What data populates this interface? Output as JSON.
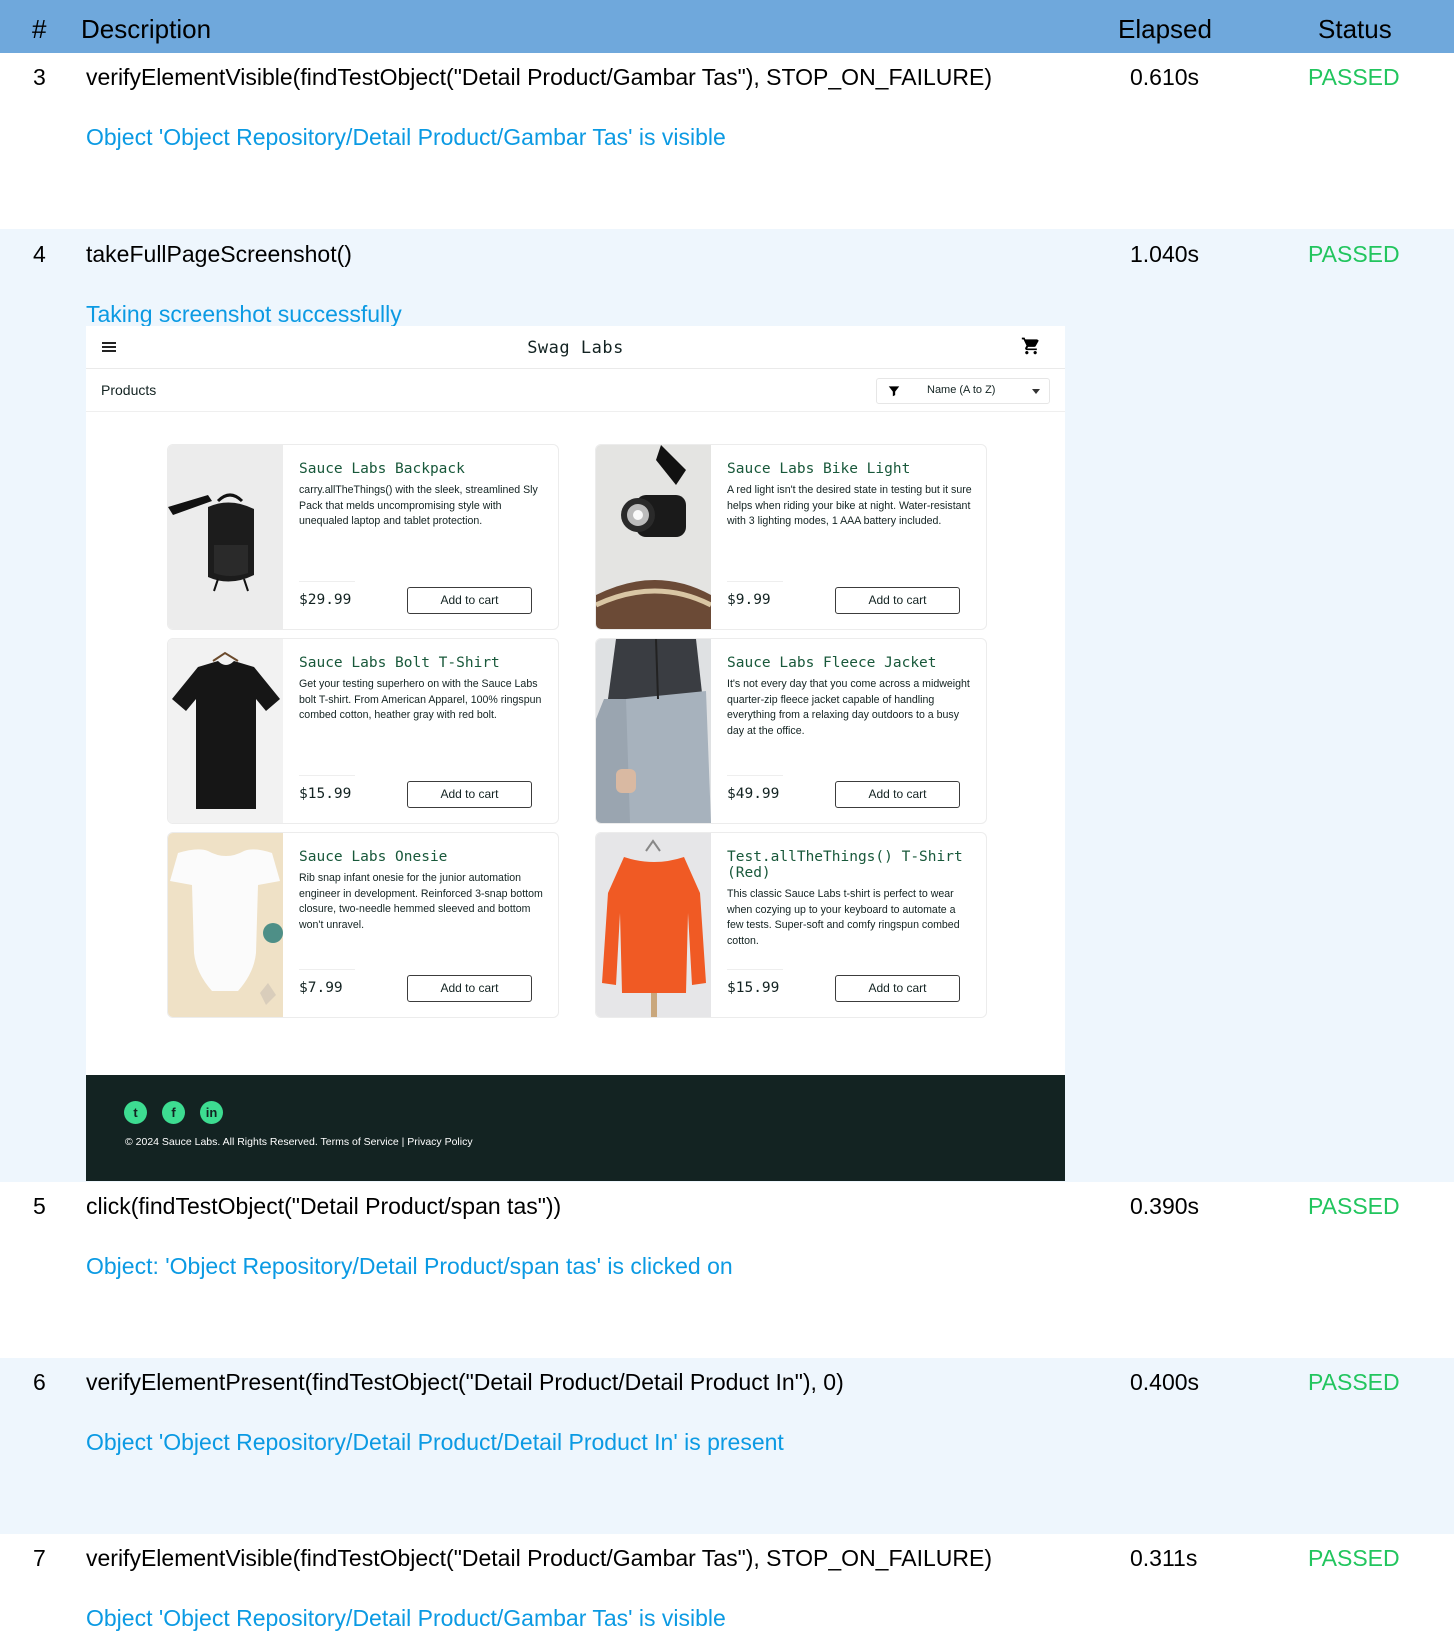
{
  "columns": {
    "num": "#",
    "description": "Description",
    "elapsed": "Elapsed",
    "status": "Status"
  },
  "steps": [
    {
      "num": "3",
      "description": "verifyElementVisible(findTestObject(\"Detail Product/Gambar Tas\"), STOP_ON_FAILURE)",
      "elapsed": "0.610s",
      "status": "PASSED",
      "log": "Object 'Object Repository/Detail Product/Gambar Tas' is visible"
    },
    {
      "num": "4",
      "description": "takeFullPageScreenshot()",
      "elapsed": "1.040s",
      "status": "PASSED",
      "log": "Taking screenshot successfully"
    },
    {
      "num": "5",
      "description": "click(findTestObject(\"Detail Product/span tas\"))",
      "elapsed": "0.390s",
      "status": "PASSED",
      "log": "Object: 'Object Repository/Detail Product/span tas' is clicked on"
    },
    {
      "num": "6",
      "description": "verifyElementPresent(findTestObject(\"Detail Product/Detail Product In\"), 0)",
      "elapsed": "0.400s",
      "status": "PASSED",
      "log": "Object 'Object Repository/Detail Product/Detail Product In' is present"
    },
    {
      "num": "7",
      "description": "verifyElementVisible(findTestObject(\"Detail Product/Gambar Tas\"), STOP_ON_FAILURE)",
      "elapsed": "0.311s",
      "status": "PASSED",
      "log": "Object 'Object Repository/Detail Product/Gambar Tas' is visible"
    }
  ],
  "screenshot": {
    "brand": "Swag Labs",
    "page_title": "Products",
    "sort_value": "Name (A to Z)",
    "products": [
      {
        "name": "Sauce Labs Backpack",
        "desc": "carry.allTheThings() with the sleek, streamlined Sly Pack that melds uncompromising style with unequaled laptop and tablet protection.",
        "price": "$29.99",
        "button": "Add to cart"
      },
      {
        "name": "Sauce Labs Bike Light",
        "desc": "A red light isn't the desired state in testing but it sure helps when riding your bike at night. Water-resistant with 3 lighting modes, 1 AAA battery included.",
        "price": "$9.99",
        "button": "Add to cart"
      },
      {
        "name": "Sauce Labs Bolt T-Shirt",
        "desc": "Get your testing superhero on with the Sauce Labs bolt T-shirt. From American Apparel, 100% ringspun combed cotton, heather gray with red bolt.",
        "price": "$15.99",
        "button": "Add to cart"
      },
      {
        "name": "Sauce Labs Fleece Jacket",
        "desc": "It's not every day that you come across a midweight quarter-zip fleece jacket capable of handling everything from a relaxing day outdoors to a busy day at the office.",
        "price": "$49.99",
        "button": "Add to cart"
      },
      {
        "name": "Sauce Labs Onesie",
        "desc": "Rib snap infant onesie for the junior automation engineer in development. Reinforced 3-snap bottom closure, two-needle hemmed sleeved and bottom won't unravel.",
        "price": "$7.99",
        "button": "Add to cart"
      },
      {
        "name": "Test.allTheThings() T-Shirt (Red)",
        "desc": "This classic Sauce Labs t-shirt is perfect to wear when cozying up to your keyboard to automate a few tests. Super-soft and comfy ringspun combed cotton.",
        "price": "$15.99",
        "button": "Add to cart"
      }
    ],
    "footer_text": "© 2024 Sauce Labs. All Rights Reserved. Terms of Service | Privacy Policy",
    "social": [
      {
        "icon": "twitter-icon",
        "glyph": "t"
      },
      {
        "icon": "facebook-icon",
        "glyph": "f"
      },
      {
        "icon": "linkedin-icon",
        "glyph": "in"
      }
    ]
  },
  "colors": {
    "header_bg": "#6fa8dc",
    "shaded_row": "#eef6fd",
    "passed": "#22c55e",
    "log_text": "#0b9ae3",
    "footer_bg": "#132322",
    "product_name": "#18583a"
  }
}
